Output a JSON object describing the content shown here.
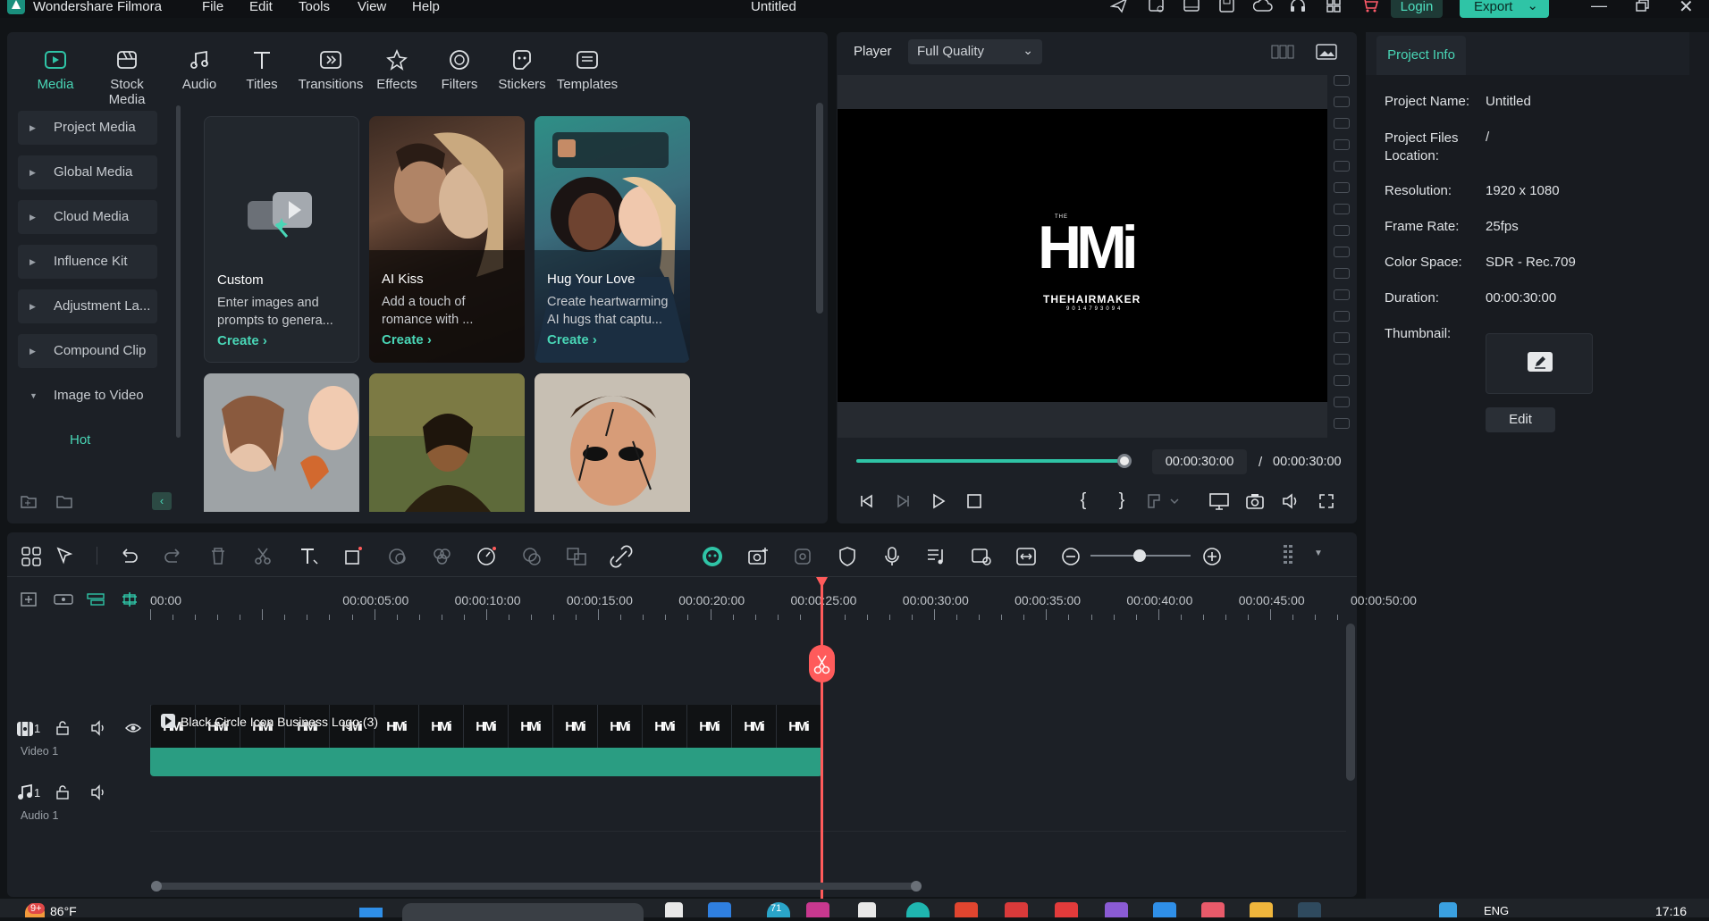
{
  "app": {
    "name": "Wondershare Filmora",
    "title": "Untitled"
  },
  "menu": [
    "File",
    "Edit",
    "Tools",
    "View",
    "Help"
  ],
  "header": {
    "login_label": "Login",
    "export_label": "Export"
  },
  "colors": {
    "accent": "#2fc4a6",
    "teal_clip": "#2a9d82",
    "playhead": "#ff5b5b",
    "bg": "#111417",
    "panel": "#1c2026"
  },
  "media_tabs": [
    {
      "label": "Media",
      "icon": "media-icon",
      "active": true
    },
    {
      "label": "Stock Media",
      "icon": "stock-media-icon"
    },
    {
      "label": "Audio",
      "icon": "audio-icon"
    },
    {
      "label": "Titles",
      "icon": "titles-icon"
    },
    {
      "label": "Transitions",
      "icon": "transitions-icon"
    },
    {
      "label": "Effects",
      "icon": "effects-icon"
    },
    {
      "label": "Filters",
      "icon": "filters-icon"
    },
    {
      "label": "Stickers",
      "icon": "stickers-icon"
    },
    {
      "label": "Templates",
      "icon": "templates-icon"
    }
  ],
  "sidebar": {
    "items": [
      "Project Media",
      "Global Media",
      "Cloud Media",
      "Influence Kit",
      "Adjustment La...",
      "Compound Clip",
      "Image to Video"
    ],
    "hot_label": "Hot"
  },
  "cards": [
    {
      "title": "Custom",
      "desc": "Enter images and prompts to genera...",
      "cta": "Create"
    },
    {
      "title": "AI Kiss",
      "desc": "Add a touch of romance with ...",
      "cta": "Create"
    },
    {
      "title": "Hug Your Love",
      "desc": "Create heartwarming AI hugs that captu...",
      "cta": "Create"
    }
  ],
  "player": {
    "label": "Player",
    "quality": "Full Quality",
    "logo_main": "HMi",
    "logo_top": "THE",
    "logo_name": "THEHAIRMAKER",
    "logo_phone": "9014793094",
    "current_time": "00:00:30:00",
    "separator": "/",
    "total_time": "00:00:30:00",
    "progress": 1.0
  },
  "project_info": {
    "tab_label": "Project Info",
    "rows": [
      {
        "label": "Project Name:",
        "value": "Untitled"
      },
      {
        "label": "Project Files Location:",
        "value": "/"
      },
      {
        "label": "Resolution:",
        "value": "1920 x 1080"
      },
      {
        "label": "Frame Rate:",
        "value": "25fps"
      },
      {
        "label": "Color Space:",
        "value": "SDR - Rec.709"
      },
      {
        "label": "Duration:",
        "value": "00:00:30:00"
      },
      {
        "label": "Thumbnail:",
        "value": ""
      }
    ],
    "edit_label": "Edit"
  },
  "timeline": {
    "ruler": [
      "00:00",
      "00:00:05:00",
      "00:00:10:00",
      "00:00:15:00",
      "00:00:20:00",
      "00:00:25:00",
      "00:00:30:00",
      "00:00:35:00",
      "00:00:40:00",
      "00:00:45:00",
      "00:00:50:00"
    ],
    "video_track": {
      "label": "Video 1",
      "num": "1"
    },
    "audio_track": {
      "label": "Audio 1",
      "num": "1"
    },
    "clip_name": "Black Circle Icon Business Logo (3)",
    "clip_frame_text": "HMi"
  },
  "taskbar": {
    "temp": "86°F",
    "badge": "9+",
    "lang": "ENG",
    "time": "17:16",
    "chat_badge": "71"
  }
}
